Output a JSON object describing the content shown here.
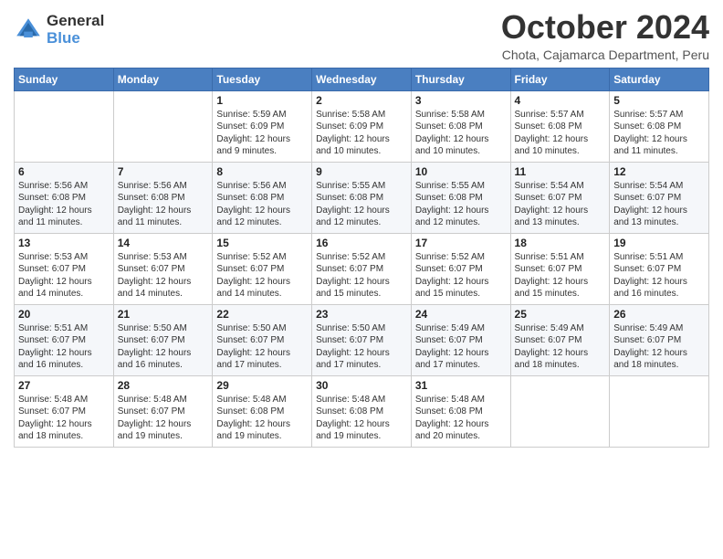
{
  "logo": {
    "general": "General",
    "blue": "Blue"
  },
  "title": "October 2024",
  "subtitle": "Chota, Cajamarca Department, Peru",
  "days_of_week": [
    "Sunday",
    "Monday",
    "Tuesday",
    "Wednesday",
    "Thursday",
    "Friday",
    "Saturday"
  ],
  "weeks": [
    [
      {
        "day": "",
        "sunrise": "",
        "sunset": "",
        "daylight": ""
      },
      {
        "day": "",
        "sunrise": "",
        "sunset": "",
        "daylight": ""
      },
      {
        "day": "1",
        "sunrise": "Sunrise: 5:59 AM",
        "sunset": "Sunset: 6:09 PM",
        "daylight": "Daylight: 12 hours and 9 minutes."
      },
      {
        "day": "2",
        "sunrise": "Sunrise: 5:58 AM",
        "sunset": "Sunset: 6:09 PM",
        "daylight": "Daylight: 12 hours and 10 minutes."
      },
      {
        "day": "3",
        "sunrise": "Sunrise: 5:58 AM",
        "sunset": "Sunset: 6:08 PM",
        "daylight": "Daylight: 12 hours and 10 minutes."
      },
      {
        "day": "4",
        "sunrise": "Sunrise: 5:57 AM",
        "sunset": "Sunset: 6:08 PM",
        "daylight": "Daylight: 12 hours and 10 minutes."
      },
      {
        "day": "5",
        "sunrise": "Sunrise: 5:57 AM",
        "sunset": "Sunset: 6:08 PM",
        "daylight": "Daylight: 12 hours and 11 minutes."
      }
    ],
    [
      {
        "day": "6",
        "sunrise": "Sunrise: 5:56 AM",
        "sunset": "Sunset: 6:08 PM",
        "daylight": "Daylight: 12 hours and 11 minutes."
      },
      {
        "day": "7",
        "sunrise": "Sunrise: 5:56 AM",
        "sunset": "Sunset: 6:08 PM",
        "daylight": "Daylight: 12 hours and 11 minutes."
      },
      {
        "day": "8",
        "sunrise": "Sunrise: 5:56 AM",
        "sunset": "Sunset: 6:08 PM",
        "daylight": "Daylight: 12 hours and 12 minutes."
      },
      {
        "day": "9",
        "sunrise": "Sunrise: 5:55 AM",
        "sunset": "Sunset: 6:08 PM",
        "daylight": "Daylight: 12 hours and 12 minutes."
      },
      {
        "day": "10",
        "sunrise": "Sunrise: 5:55 AM",
        "sunset": "Sunset: 6:08 PM",
        "daylight": "Daylight: 12 hours and 12 minutes."
      },
      {
        "day": "11",
        "sunrise": "Sunrise: 5:54 AM",
        "sunset": "Sunset: 6:07 PM",
        "daylight": "Daylight: 12 hours and 13 minutes."
      },
      {
        "day": "12",
        "sunrise": "Sunrise: 5:54 AM",
        "sunset": "Sunset: 6:07 PM",
        "daylight": "Daylight: 12 hours and 13 minutes."
      }
    ],
    [
      {
        "day": "13",
        "sunrise": "Sunrise: 5:53 AM",
        "sunset": "Sunset: 6:07 PM",
        "daylight": "Daylight: 12 hours and 14 minutes."
      },
      {
        "day": "14",
        "sunrise": "Sunrise: 5:53 AM",
        "sunset": "Sunset: 6:07 PM",
        "daylight": "Daylight: 12 hours and 14 minutes."
      },
      {
        "day": "15",
        "sunrise": "Sunrise: 5:52 AM",
        "sunset": "Sunset: 6:07 PM",
        "daylight": "Daylight: 12 hours and 14 minutes."
      },
      {
        "day": "16",
        "sunrise": "Sunrise: 5:52 AM",
        "sunset": "Sunset: 6:07 PM",
        "daylight": "Daylight: 12 hours and 15 minutes."
      },
      {
        "day": "17",
        "sunrise": "Sunrise: 5:52 AM",
        "sunset": "Sunset: 6:07 PM",
        "daylight": "Daylight: 12 hours and 15 minutes."
      },
      {
        "day": "18",
        "sunrise": "Sunrise: 5:51 AM",
        "sunset": "Sunset: 6:07 PM",
        "daylight": "Daylight: 12 hours and 15 minutes."
      },
      {
        "day": "19",
        "sunrise": "Sunrise: 5:51 AM",
        "sunset": "Sunset: 6:07 PM",
        "daylight": "Daylight: 12 hours and 16 minutes."
      }
    ],
    [
      {
        "day": "20",
        "sunrise": "Sunrise: 5:51 AM",
        "sunset": "Sunset: 6:07 PM",
        "daylight": "Daylight: 12 hours and 16 minutes."
      },
      {
        "day": "21",
        "sunrise": "Sunrise: 5:50 AM",
        "sunset": "Sunset: 6:07 PM",
        "daylight": "Daylight: 12 hours and 16 minutes."
      },
      {
        "day": "22",
        "sunrise": "Sunrise: 5:50 AM",
        "sunset": "Sunset: 6:07 PM",
        "daylight": "Daylight: 12 hours and 17 minutes."
      },
      {
        "day": "23",
        "sunrise": "Sunrise: 5:50 AM",
        "sunset": "Sunset: 6:07 PM",
        "daylight": "Daylight: 12 hours and 17 minutes."
      },
      {
        "day": "24",
        "sunrise": "Sunrise: 5:49 AM",
        "sunset": "Sunset: 6:07 PM",
        "daylight": "Daylight: 12 hours and 17 minutes."
      },
      {
        "day": "25",
        "sunrise": "Sunrise: 5:49 AM",
        "sunset": "Sunset: 6:07 PM",
        "daylight": "Daylight: 12 hours and 18 minutes."
      },
      {
        "day": "26",
        "sunrise": "Sunrise: 5:49 AM",
        "sunset": "Sunset: 6:07 PM",
        "daylight": "Daylight: 12 hours and 18 minutes."
      }
    ],
    [
      {
        "day": "27",
        "sunrise": "Sunrise: 5:48 AM",
        "sunset": "Sunset: 6:07 PM",
        "daylight": "Daylight: 12 hours and 18 minutes."
      },
      {
        "day": "28",
        "sunrise": "Sunrise: 5:48 AM",
        "sunset": "Sunset: 6:07 PM",
        "daylight": "Daylight: 12 hours and 19 minutes."
      },
      {
        "day": "29",
        "sunrise": "Sunrise: 5:48 AM",
        "sunset": "Sunset: 6:08 PM",
        "daylight": "Daylight: 12 hours and 19 minutes."
      },
      {
        "day": "30",
        "sunrise": "Sunrise: 5:48 AM",
        "sunset": "Sunset: 6:08 PM",
        "daylight": "Daylight: 12 hours and 19 minutes."
      },
      {
        "day": "31",
        "sunrise": "Sunrise: 5:48 AM",
        "sunset": "Sunset: 6:08 PM",
        "daylight": "Daylight: 12 hours and 20 minutes."
      },
      {
        "day": "",
        "sunrise": "",
        "sunset": "",
        "daylight": ""
      },
      {
        "day": "",
        "sunrise": "",
        "sunset": "",
        "daylight": ""
      }
    ]
  ]
}
